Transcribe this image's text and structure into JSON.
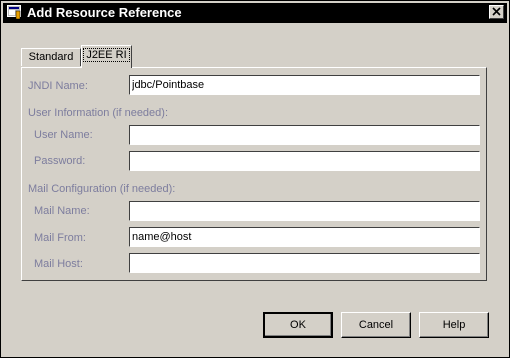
{
  "window": {
    "title": "Add Resource Reference",
    "close_icon": "close-icon"
  },
  "tabs": [
    {
      "label": "Standard",
      "active": false
    },
    {
      "label": "J2EE RI",
      "active": true
    }
  ],
  "form": {
    "jndi_label": "JNDI Name:",
    "jndi_value": "jdbc/Pointbase",
    "user_section": "User Information   (if needed):",
    "user_name_label": "User Name:",
    "user_name_value": "",
    "password_label": "Password:",
    "password_value": "",
    "mail_section": "Mail Configuration (if needed):",
    "mail_name_label": "Mail Name:",
    "mail_name_value": "",
    "mail_from_label": "Mail From:",
    "mail_from_value": "name@host",
    "mail_host_label": "Mail Host:",
    "mail_host_value": ""
  },
  "buttons": {
    "ok": "OK",
    "cancel": "Cancel",
    "help": "Help"
  }
}
